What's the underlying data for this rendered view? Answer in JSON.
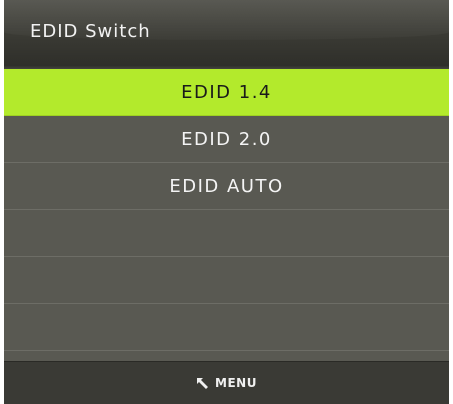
{
  "header": {
    "title": "EDID Switch"
  },
  "menu": {
    "items": [
      {
        "label": "EDID 1.4",
        "selected": true
      },
      {
        "label": "EDID 2.0",
        "selected": false
      },
      {
        "label": "EDID AUTO",
        "selected": false
      },
      {
        "label": "",
        "selected": false
      },
      {
        "label": "",
        "selected": false
      },
      {
        "label": "",
        "selected": false
      }
    ]
  },
  "footer": {
    "icon": "return-arrow-icon",
    "label": "MENU"
  },
  "colors": {
    "selected": "#b3ea2c",
    "panel": "#595952",
    "header": "#3a3a34",
    "footer": "#3a3a35"
  }
}
